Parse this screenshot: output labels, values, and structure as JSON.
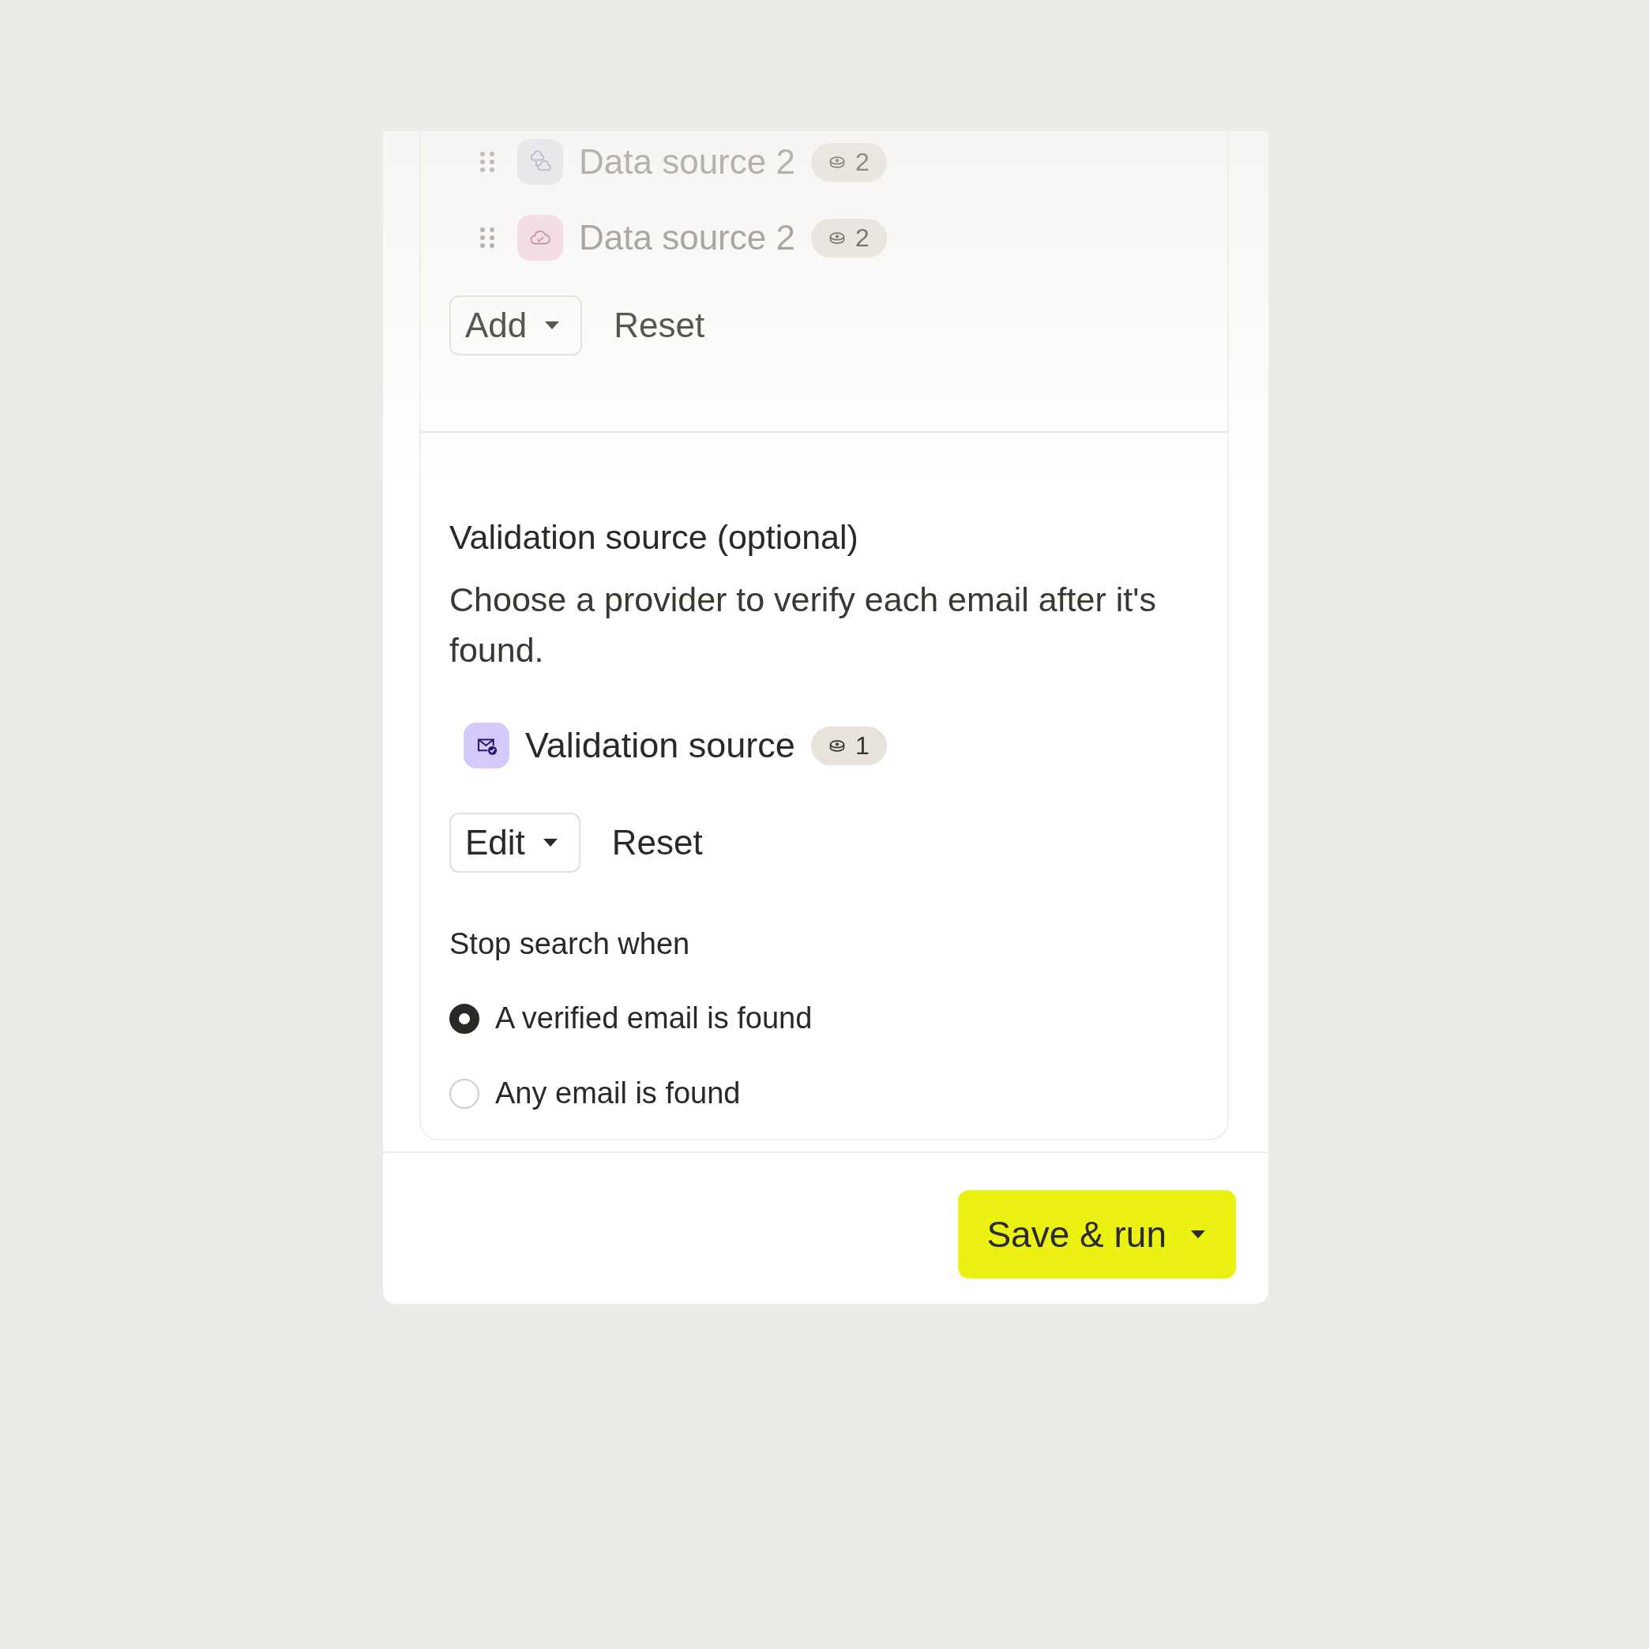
{
  "sources": [
    {
      "kind": "clouds",
      "name": "Data source 2",
      "count": "2"
    },
    {
      "kind": "cloud-check",
      "name": "Data source 2",
      "count": "2"
    }
  ],
  "source_actions": {
    "add": "Add",
    "reset": "Reset"
  },
  "validation": {
    "title": "Validation source (optional)",
    "description": "Choose a provider to verify each email after it's found.",
    "source": {
      "kind": "mail-check",
      "name": "Validation source",
      "count": "1"
    },
    "edit": "Edit",
    "reset": "Reset"
  },
  "stop_search": {
    "label": "Stop search when",
    "options": [
      {
        "label": "A verified email is found",
        "selected": true
      },
      {
        "label": "Any email is found",
        "selected": false
      }
    ]
  },
  "footer": {
    "primary": "Save & run"
  }
}
